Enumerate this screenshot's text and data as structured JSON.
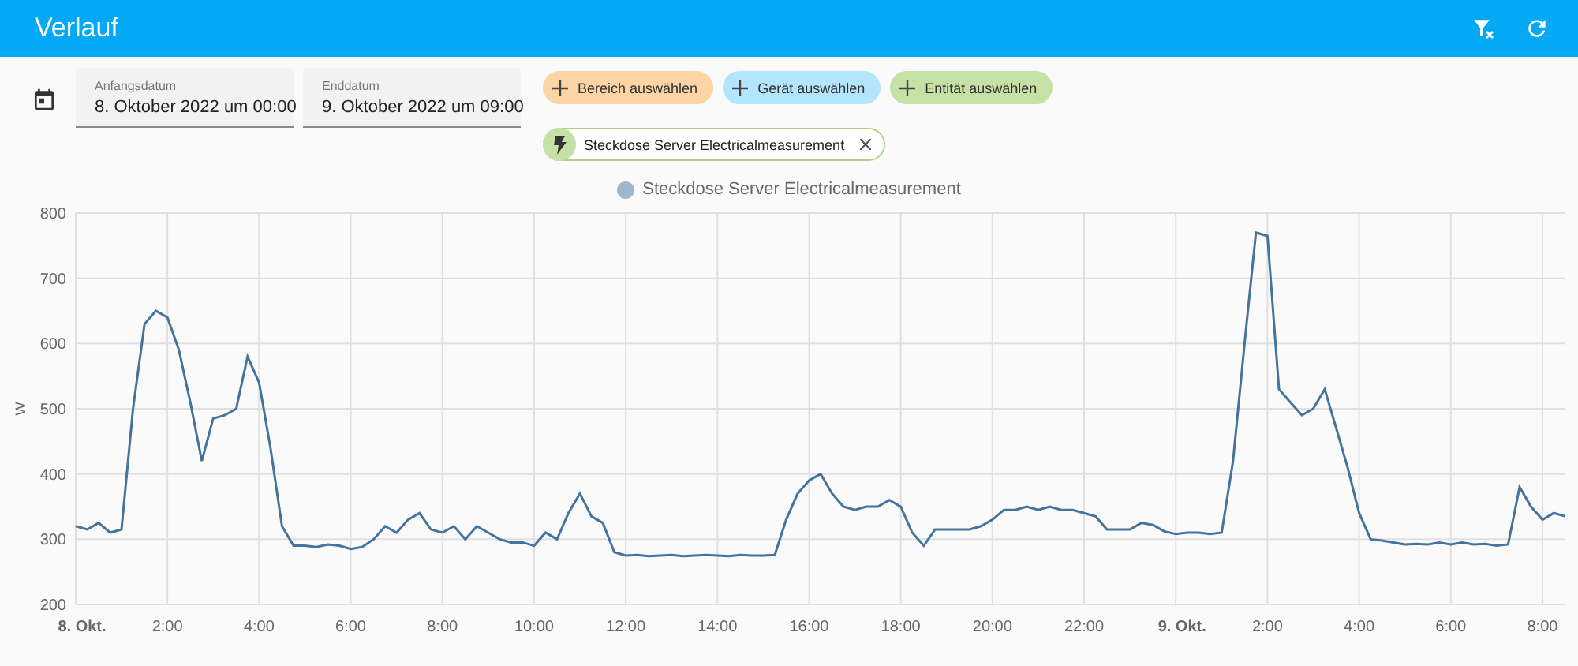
{
  "header": {
    "title": "Verlauf"
  },
  "date_fields": [
    {
      "label": "Anfangsdatum",
      "value": "8. Oktober 2022 um 00:00"
    },
    {
      "label": "Enddatum",
      "value": "9. Oktober 2022 um 09:00"
    }
  ],
  "target_chips": [
    {
      "label": "Bereich auswählen",
      "color": "#fdd4a4"
    },
    {
      "label": "Gerät auswählen",
      "color": "#b3e5fc"
    },
    {
      "label": "Entität auswählen",
      "color": "#c5e1a5"
    }
  ],
  "selected_entities": [
    {
      "label": "Steckdose Server Electricalmeasurement"
    }
  ],
  "chart": {
    "chart_data": {
      "type": "line",
      "grid": true,
      "ylabel": "W",
      "xlim": [
        "2022-10-08T00:00",
        "2022-10-09T08:30"
      ],
      "ylim": [
        200,
        800
      ],
      "yticks": [
        200,
        300,
        400,
        500,
        600,
        700,
        800
      ],
      "xticks": [
        {
          "value": "2022-10-08T00:00",
          "label": "8. Okt."
        },
        {
          "value": "2022-10-08T02:00",
          "label": "2:00"
        },
        {
          "value": "2022-10-08T04:00",
          "label": "4:00"
        },
        {
          "value": "2022-10-08T06:00",
          "label": "6:00"
        },
        {
          "value": "2022-10-08T08:00",
          "label": "8:00"
        },
        {
          "value": "2022-10-08T10:00",
          "label": "10:00"
        },
        {
          "value": "2022-10-08T12:00",
          "label": "12:00"
        },
        {
          "value": "2022-10-08T14:00",
          "label": "14:00"
        },
        {
          "value": "2022-10-08T16:00",
          "label": "16:00"
        },
        {
          "value": "2022-10-08T18:00",
          "label": "18:00"
        },
        {
          "value": "2022-10-08T20:00",
          "label": "20:00"
        },
        {
          "value": "2022-10-08T22:00",
          "label": "22:00"
        },
        {
          "value": "2022-10-09T00:00",
          "label": "9. Okt."
        },
        {
          "value": "2022-10-09T02:00",
          "label": "2:00"
        },
        {
          "value": "2022-10-09T04:00",
          "label": "4:00"
        },
        {
          "value": "2022-10-09T06:00",
          "label": "6:00"
        },
        {
          "value": "2022-10-09T08:00",
          "label": "8:00"
        }
      ],
      "x": [
        "2022-10-08T00:00",
        "2022-10-08T00:15",
        "2022-10-08T00:30",
        "2022-10-08T00:45",
        "2022-10-08T01:00",
        "2022-10-08T01:15",
        "2022-10-08T01:30",
        "2022-10-08T01:45",
        "2022-10-08T02:00",
        "2022-10-08T02:15",
        "2022-10-08T02:30",
        "2022-10-08T02:45",
        "2022-10-08T03:00",
        "2022-10-08T03:15",
        "2022-10-08T03:30",
        "2022-10-08T03:45",
        "2022-10-08T04:00",
        "2022-10-08T04:15",
        "2022-10-08T04:30",
        "2022-10-08T04:45",
        "2022-10-08T05:00",
        "2022-10-08T05:15",
        "2022-10-08T05:30",
        "2022-10-08T05:45",
        "2022-10-08T06:00",
        "2022-10-08T06:15",
        "2022-10-08T06:30",
        "2022-10-08T06:45",
        "2022-10-08T07:00",
        "2022-10-08T07:15",
        "2022-10-08T07:30",
        "2022-10-08T07:45",
        "2022-10-08T08:00",
        "2022-10-08T08:15",
        "2022-10-08T08:30",
        "2022-10-08T08:45",
        "2022-10-08T09:00",
        "2022-10-08T09:15",
        "2022-10-08T09:30",
        "2022-10-08T09:45",
        "2022-10-08T10:00",
        "2022-10-08T10:15",
        "2022-10-08T10:30",
        "2022-10-08T10:45",
        "2022-10-08T11:00",
        "2022-10-08T11:15",
        "2022-10-08T11:30",
        "2022-10-08T11:45",
        "2022-10-08T12:00",
        "2022-10-08T12:15",
        "2022-10-08T12:30",
        "2022-10-08T12:45",
        "2022-10-08T13:00",
        "2022-10-08T13:15",
        "2022-10-08T13:30",
        "2022-10-08T13:45",
        "2022-10-08T14:00",
        "2022-10-08T14:15",
        "2022-10-08T14:30",
        "2022-10-08T14:45",
        "2022-10-08T15:00",
        "2022-10-08T15:15",
        "2022-10-08T15:30",
        "2022-10-08T15:45",
        "2022-10-08T16:00",
        "2022-10-08T16:15",
        "2022-10-08T16:30",
        "2022-10-08T16:45",
        "2022-10-08T17:00",
        "2022-10-08T17:15",
        "2022-10-08T17:30",
        "2022-10-08T17:45",
        "2022-10-08T18:00",
        "2022-10-08T18:15",
        "2022-10-08T18:30",
        "2022-10-08T18:45",
        "2022-10-08T19:00",
        "2022-10-08T19:15",
        "2022-10-08T19:30",
        "2022-10-08T19:45",
        "2022-10-08T20:00",
        "2022-10-08T20:15",
        "2022-10-08T20:30",
        "2022-10-08T20:45",
        "2022-10-08T21:00",
        "2022-10-08T21:15",
        "2022-10-08T21:30",
        "2022-10-08T21:45",
        "2022-10-08T22:00",
        "2022-10-08T22:15",
        "2022-10-08T22:30",
        "2022-10-08T22:45",
        "2022-10-08T23:00",
        "2022-10-08T23:15",
        "2022-10-08T23:30",
        "2022-10-08T23:45",
        "2022-10-09T00:00",
        "2022-10-09T00:15",
        "2022-10-09T00:30",
        "2022-10-09T00:45",
        "2022-10-09T01:00",
        "2022-10-09T01:15",
        "2022-10-09T01:30",
        "2022-10-09T01:45",
        "2022-10-09T02:00",
        "2022-10-09T02:15",
        "2022-10-09T02:30",
        "2022-10-09T02:45",
        "2022-10-09T03:00",
        "2022-10-09T03:15",
        "2022-10-09T03:30",
        "2022-10-09T03:45",
        "2022-10-09T04:00",
        "2022-10-09T04:15",
        "2022-10-09T04:30",
        "2022-10-09T04:45",
        "2022-10-09T05:00",
        "2022-10-09T05:15",
        "2022-10-09T05:30",
        "2022-10-09T05:45",
        "2022-10-09T06:00",
        "2022-10-09T06:15",
        "2022-10-09T06:30",
        "2022-10-09T06:45",
        "2022-10-09T07:00",
        "2022-10-09T07:15",
        "2022-10-09T07:30",
        "2022-10-09T07:45",
        "2022-10-09T08:00",
        "2022-10-09T08:15",
        "2022-10-09T08:30"
      ],
      "series": [
        {
          "name": "Steckdose Server Electricalmeasurement",
          "color": "#44739e",
          "values": [
            320,
            315,
            325,
            310,
            315,
            500,
            630,
            650,
            640,
            590,
            510,
            420,
            485,
            490,
            500,
            580,
            540,
            440,
            320,
            290,
            290,
            288,
            292,
            290,
            285,
            288,
            300,
            320,
            310,
            330,
            340,
            315,
            310,
            320,
            300,
            320,
            310,
            300,
            295,
            295,
            290,
            310,
            300,
            340,
            370,
            335,
            325,
            280,
            275,
            276,
            274,
            275,
            276,
            274,
            275,
            276,
            275,
            274,
            276,
            275,
            275,
            276,
            330,
            370,
            390,
            400,
            370,
            350,
            345,
            350,
            350,
            360,
            350,
            310,
            290,
            315,
            315,
            315,
            315,
            320,
            330,
            345,
            345,
            350,
            345,
            350,
            345,
            345,
            340,
            335,
            315,
            315,
            315,
            325,
            322,
            312,
            308,
            310,
            310,
            308,
            310,
            420,
            600,
            770,
            765,
            530,
            510,
            490,
            500,
            530,
            470,
            410,
            340,
            300,
            298,
            295,
            292,
            293,
            292,
            295,
            292,
            295,
            292,
            293,
            290,
            292,
            380,
            350,
            330,
            340,
            335
          ]
        }
      ]
    }
  }
}
